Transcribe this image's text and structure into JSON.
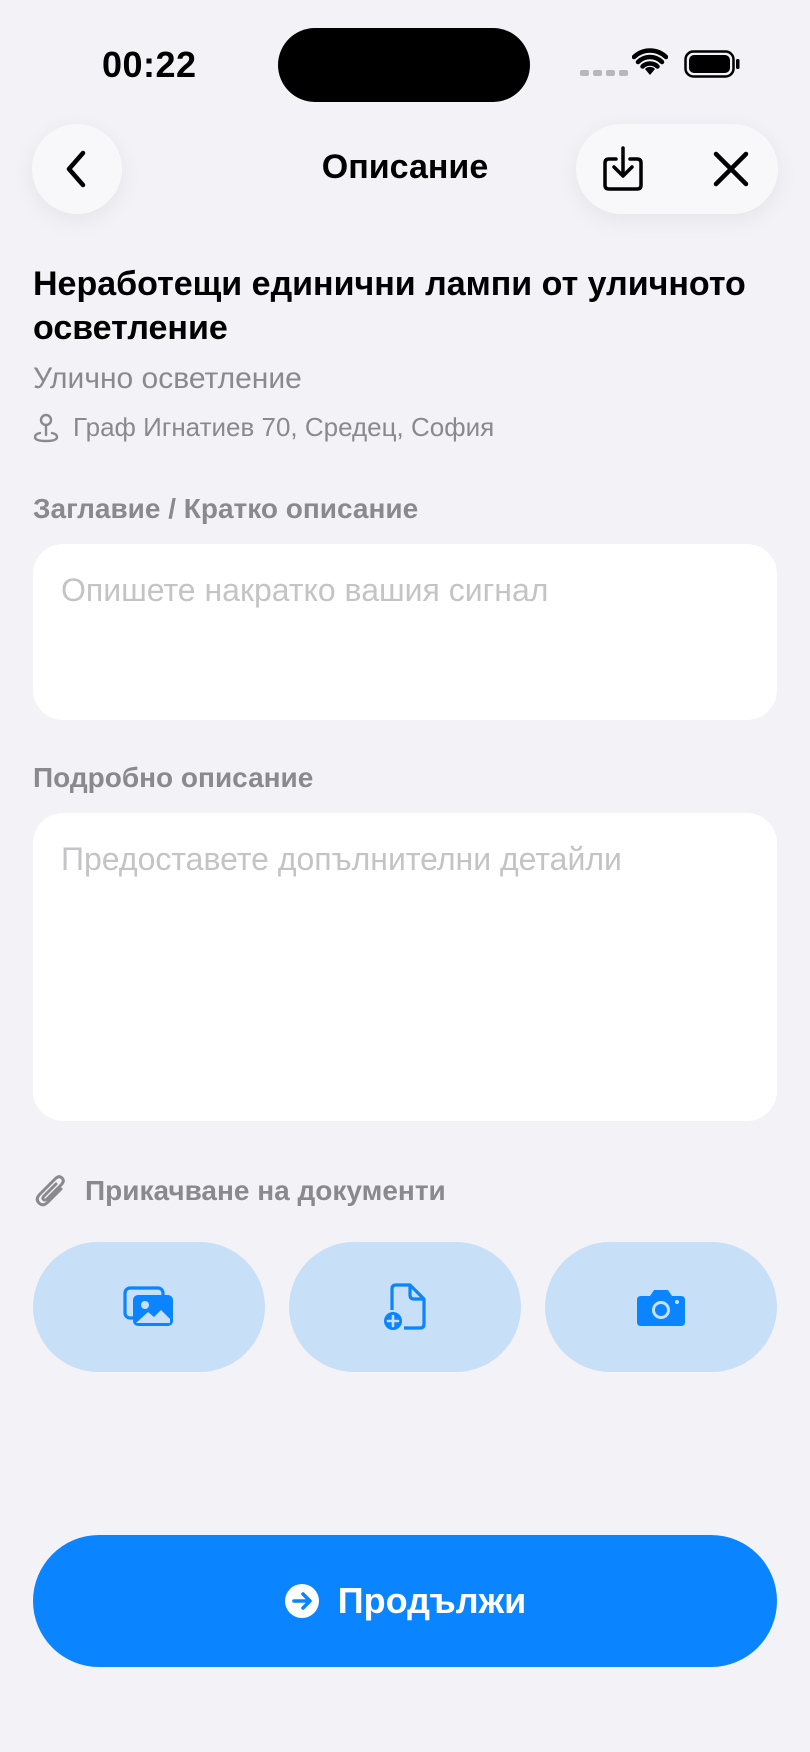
{
  "status_bar": {
    "time": "00:22"
  },
  "header": {
    "title": "Описание",
    "back_icon": "chevron-left-icon",
    "download_icon": "download-tray-icon",
    "close_icon": "close-icon"
  },
  "issue": {
    "title": "Неработещи единични лампи от уличното осветление",
    "category": "Улично осветление",
    "location_icon": "map-pin-icon",
    "location": "Граф Игнатиев 70, Средец, София"
  },
  "form": {
    "short_label": "Заглавие / Кратко описание",
    "short_placeholder": "Опишете накратко вашия сигнал",
    "detail_label": "Подробно описание",
    "detail_placeholder": "Предоставете допълнителни детайли"
  },
  "attachments": {
    "label": "Прикачване на документи",
    "icon": "paperclip-icon",
    "buttons": [
      {
        "icon": "photo-gallery-icon"
      },
      {
        "icon": "add-file-icon"
      },
      {
        "icon": "camera-icon"
      }
    ]
  },
  "continue": {
    "label": "Продължи",
    "icon": "arrow-right-circle-icon"
  },
  "colors": {
    "background": "#F2F2F7",
    "accent": "#0A84FF",
    "attach_bg": "#C8E0F7",
    "secondary_text": "#8A8A8E",
    "placeholder": "#C4C4C6"
  }
}
